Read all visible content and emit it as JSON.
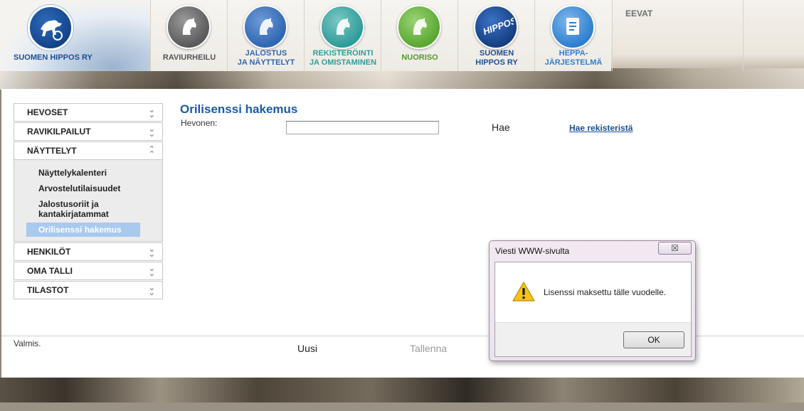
{
  "header": {
    "logo_text": "SUOMEN HIPPOS RY",
    "nav": [
      {
        "line1": "RAVIURHEILU",
        "line2": "",
        "icon": "horse-head-icon",
        "color": "#5a5a5a",
        "text_color": "#555555"
      },
      {
        "line1": "JALOSTUS",
        "line2": "JA NÄYTTELYT",
        "icon": "horse-head-icon",
        "color": "#2f67b2",
        "text_color": "#2f67b2"
      },
      {
        "line1": "REKISTERÖINTI",
        "line2": "JA OMISTAMINEN",
        "icon": "horse-head-icon",
        "color": "#2e9c9a",
        "text_color": "#2e9c9a"
      },
      {
        "line1": "NUORISO",
        "line2": "",
        "icon": "horse-head-icon",
        "color": "#5aa832",
        "text_color": "#4f9b2a"
      },
      {
        "line1": "SUOMEN",
        "line2": "HIPPOS RY",
        "icon": "hippos-badge-icon",
        "color": "#1d4f9a",
        "text_color": "#1d4f9a"
      },
      {
        "line1": "HEPPA-",
        "line2": "JÄRJESTELMÄ",
        "icon": "document-icon",
        "color": "#2e7fcf",
        "text_color": "#2e7fcf"
      }
    ],
    "eevat": "EEVAT"
  },
  "sidebar": {
    "items": [
      {
        "label": "HEVOSET",
        "expanded": false
      },
      {
        "label": "RAVIKILPAILUT",
        "expanded": false
      },
      {
        "label": "NÄYTTELYT",
        "expanded": true
      },
      {
        "label": "HENKILÖT",
        "expanded": false
      },
      {
        "label": "OMA TALLI",
        "expanded": false
      },
      {
        "label": "TILASTOT",
        "expanded": false
      }
    ],
    "subitems": [
      "Näyttelykalenteri",
      "Arvostelutilaisuudet",
      "Jalostusoriit ja kantakirjatammat",
      "Orilisenssi hakemus"
    ],
    "active_subitem": "Orilisenssi hakemus"
  },
  "form": {
    "title": "Orilisenssi hakemus",
    "horse_label": "Hevonen:",
    "horse_value": "",
    "search_button": "Hae",
    "registry_link": "Hae rekisteristä"
  },
  "status": {
    "text": "Valmis.",
    "new_button": "Uusi",
    "save_button": "Tallenna"
  },
  "dialog": {
    "title": "Viesti WWW-sivulta",
    "close_symbol": "☒",
    "message": "Lisenssi maksettu tälle vuodelle.",
    "ok_label": "OK"
  },
  "colors": {
    "accent_blue": "#1a5aa6",
    "active_item_bg": "#a9c9ee",
    "link_blue": "#1a4f97"
  }
}
